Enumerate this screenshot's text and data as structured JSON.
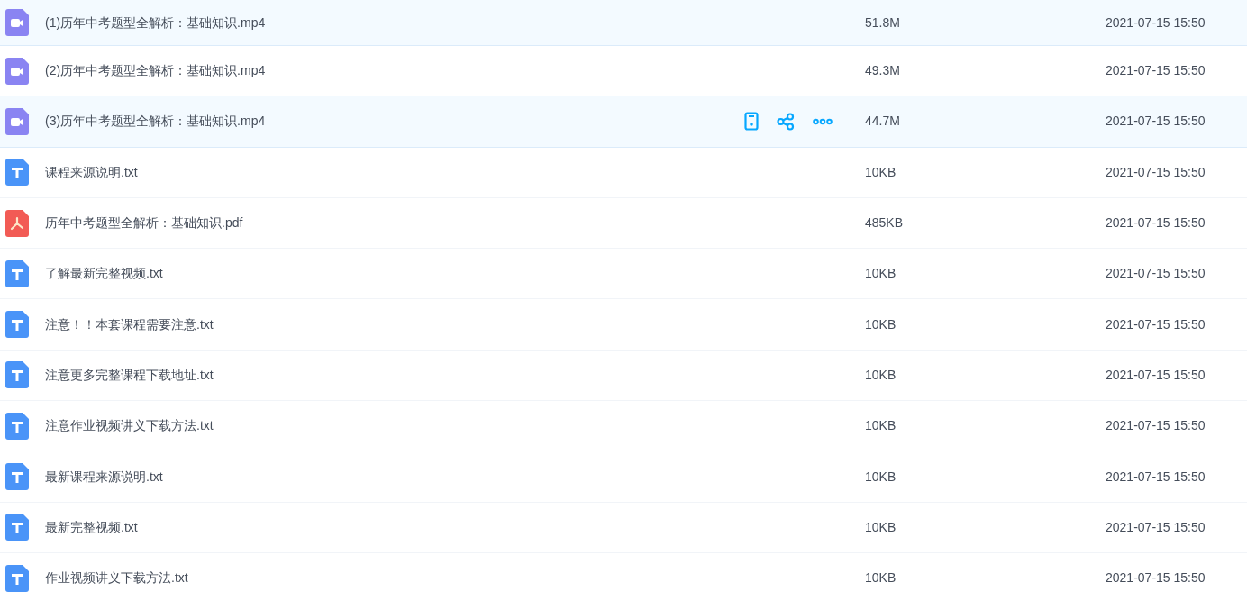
{
  "files": [
    {
      "kind": "video",
      "name": "(1)历年中考题型全解析：基础知识.mp4",
      "size": "51.8M",
      "modified": "2021-07-15 15:50",
      "selected": true,
      "hovered": false
    },
    {
      "kind": "video",
      "name": "(2)历年中考题型全解析：基础知识.mp4",
      "size": "49.3M",
      "modified": "2021-07-15 15:50",
      "selected": false,
      "hovered": false
    },
    {
      "kind": "video",
      "name": "(3)历年中考题型全解析：基础知识.mp4",
      "size": "44.7M",
      "modified": "2021-07-15 15:50",
      "selected": true,
      "hovered": true
    },
    {
      "kind": "text",
      "name": "课程来源说明.txt",
      "size": "10KB",
      "modified": "2021-07-15 15:50",
      "selected": false,
      "hovered": false
    },
    {
      "kind": "pdf",
      "name": "历年中考题型全解析：基础知识.pdf",
      "size": "485KB",
      "modified": "2021-07-15 15:50",
      "selected": false,
      "hovered": false
    },
    {
      "kind": "text",
      "name": "了解最新完整视频.txt",
      "size": "10KB",
      "modified": "2021-07-15 15:50",
      "selected": false,
      "hovered": false
    },
    {
      "kind": "text",
      "name": "注意！！本套课程需要注意.txt",
      "size": "10KB",
      "modified": "2021-07-15 15:50",
      "selected": false,
      "hovered": false
    },
    {
      "kind": "text",
      "name": "注意更多完整课程下载地址.txt",
      "size": "10KB",
      "modified": "2021-07-15 15:50",
      "selected": false,
      "hovered": false
    },
    {
      "kind": "text",
      "name": "注意作业视频讲义下载方法.txt",
      "size": "10KB",
      "modified": "2021-07-15 15:50",
      "selected": false,
      "hovered": false
    },
    {
      "kind": "text",
      "name": "最新课程来源说明.txt",
      "size": "10KB",
      "modified": "2021-07-15 15:50",
      "selected": false,
      "hovered": false
    },
    {
      "kind": "text",
      "name": "最新完整视频.txt",
      "size": "10KB",
      "modified": "2021-07-15 15:50",
      "selected": false,
      "hovered": false
    },
    {
      "kind": "text",
      "name": "作业视频讲义下载方法.txt",
      "size": "10KB",
      "modified": "2021-07-15 15:50",
      "selected": false,
      "hovered": false
    }
  ]
}
